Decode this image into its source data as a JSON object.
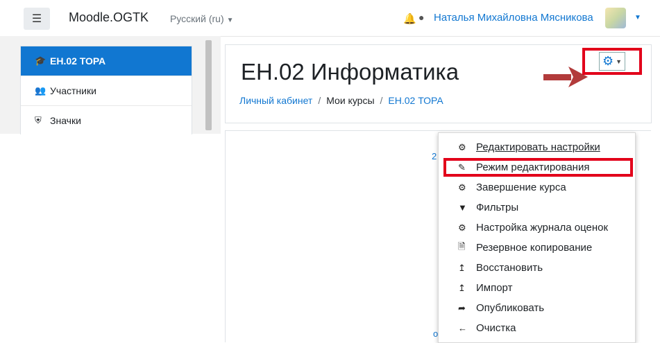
{
  "navbar": {
    "brand": "Moodle.OGTK",
    "language": "Русский (ru)",
    "user_name": "Наталья Михайловна Мясникова"
  },
  "drawer": {
    "items": [
      {
        "icon": "graduation-cap-icon",
        "label": "ЕН.02 ТОРА"
      },
      {
        "icon": "users-icon",
        "label": "Участники"
      },
      {
        "icon": "shield-icon",
        "label": "Значки"
      }
    ]
  },
  "course": {
    "title": "ЕН.02 Информатика",
    "breadcrumb": [
      "Личный кабинет",
      "Мои курсы",
      "ЕН.02 ТОРА"
    ]
  },
  "menu": {
    "items": [
      {
        "icon": "gear-icon",
        "label": "Редактировать настройки"
      },
      {
        "icon": "pencil-icon",
        "label": "Режим редактирования"
      },
      {
        "icon": "gear-icon",
        "label": "Завершение курса"
      },
      {
        "icon": "filter-icon",
        "label": "Фильтры"
      },
      {
        "icon": "gear-icon",
        "label": "Настройка журнала оценок"
      },
      {
        "icon": "file-archive-icon",
        "label": "Резервное копирование"
      },
      {
        "icon": "level-up-icon",
        "label": "Восстановить"
      },
      {
        "icon": "level-up-icon",
        "label": "Импорт"
      },
      {
        "icon": "share-icon",
        "label": "Опубликовать"
      },
      {
        "icon": "arrow-left-icon",
        "label": "Очистка"
      }
    ]
  },
  "colors": {
    "accent": "#1177d1",
    "highlight": "#e2001a",
    "arrow": "#b23b3b"
  }
}
